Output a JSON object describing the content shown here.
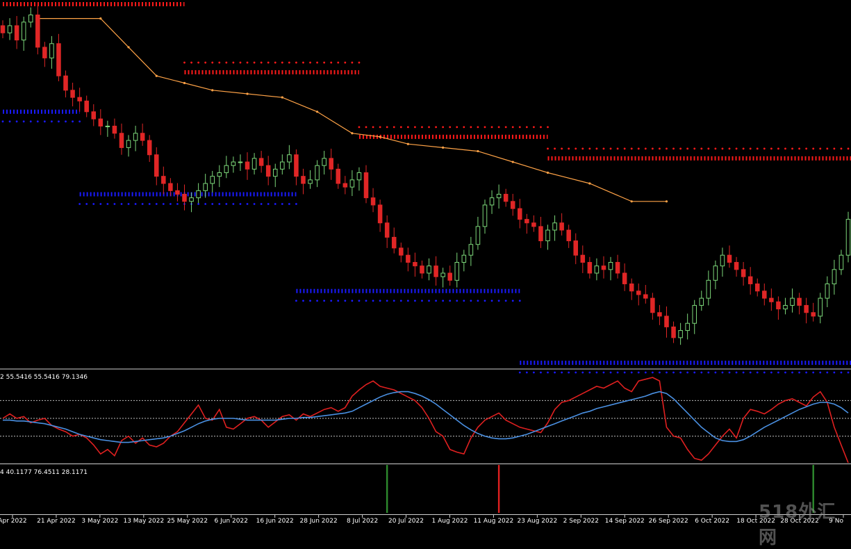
{
  "panels": {
    "main": {
      "label": "",
      "colors": {
        "bull": "#7dd87a",
        "bear": "#e02626",
        "resistance": "#ff1a1a",
        "support": "#1a1aff",
        "trail": "#ffa347",
        "trail_up": "#c8ff6a"
      }
    },
    "oscillator": {
      "label": "2 55.5416 55.5416 79.1346",
      "levels": [
        70,
        50,
        30
      ],
      "colors": {
        "main": "#e02020",
        "signal": "#4a90e2",
        "low": "#e8e84a",
        "green": "#2e8b2e"
      }
    },
    "signals": {
      "label": "4 40.1177 76.4511 28.1171",
      "colors": {
        "buy": "#2e8b2e",
        "sell": "#e02020"
      }
    }
  },
  "watermark": "518外汇网",
  "chart_data": [
    {
      "type": "candlestick",
      "title": "",
      "xlabel": "",
      "ylabel": "",
      "x_tick_labels": [
        "Apr 2022",
        "21 Apr 2022",
        "3 May 2022",
        "13 May 2022",
        "25 May 2022",
        "6 Jun 2022",
        "16 Jun 2022",
        "28 Jun 2022",
        "8 Jul 2022",
        "20 Jul 2022",
        "1 Aug 2022",
        "11 Aug 2022",
        "23 Aug 2022",
        "2 Sep 2022",
        "14 Sep 2022",
        "26 Sep 2022",
        "6 Oct 2022",
        "18 Oct 2022",
        "28 Oct 2022",
        "9 No"
      ],
      "ylim": [
        0,
        100
      ],
      "close": [
        92,
        94,
        90,
        95,
        97,
        88,
        85,
        89,
        80,
        76,
        74,
        73,
        70,
        68,
        66,
        66,
        64,
        60,
        62,
        64,
        62,
        58,
        52,
        50,
        48,
        47,
        45,
        46,
        48,
        50,
        52,
        53,
        55,
        56,
        56,
        54,
        57,
        55,
        52,
        54,
        56,
        58,
        52,
        50,
        51,
        55,
        57,
        54,
        50,
        49,
        51,
        53,
        46,
        44,
        39,
        35,
        32,
        30,
        28,
        27,
        25,
        27,
        24,
        25,
        23,
        28,
        30,
        33,
        38,
        44,
        46,
        47,
        45,
        43,
        40,
        39,
        38,
        34,
        37,
        39,
        37,
        34,
        30,
        28,
        25,
        27,
        26,
        28,
        25,
        22,
        20,
        19,
        18,
        14,
        13,
        10,
        7,
        9,
        11,
        16,
        18,
        23,
        27,
        30,
        28,
        26,
        24,
        22,
        20,
        18,
        17,
        15,
        16,
        18,
        16,
        14,
        13,
        18,
        22,
        26,
        30,
        40
      ],
      "resistance_levels": [
        [
          0,
          26,
          100
        ],
        [
          26,
          51,
          81
        ],
        [
          51,
          78,
          63
        ],
        [
          78,
          122,
          57
        ]
      ],
      "support_levels": [
        [
          0,
          11,
          70
        ],
        [
          11,
          42,
          47
        ],
        [
          42,
          74,
          20
        ],
        [
          74,
          122,
          0
        ]
      ],
      "trail_line": [
        [
          5,
          96
        ],
        [
          14,
          96
        ],
        [
          18,
          88
        ],
        [
          22,
          80
        ],
        [
          26,
          78
        ],
        [
          30,
          76
        ],
        [
          35,
          75
        ],
        [
          40,
          74
        ],
        [
          45,
          70
        ],
        [
          50,
          64
        ],
        [
          54,
          63
        ],
        [
          58,
          61
        ],
        [
          63,
          60
        ],
        [
          68,
          59
        ],
        [
          73,
          56
        ],
        [
          78,
          53
        ],
        [
          84,
          50
        ],
        [
          90,
          45
        ],
        [
          95,
          45
        ]
      ]
    },
    {
      "type": "line",
      "title": "",
      "x_tick_labels": [],
      "ylim": [
        0,
        100
      ],
      "levels": [
        70,
        50,
        30
      ],
      "series": [
        {
          "values": [
            50,
            55,
            50,
            52,
            45,
            48,
            50,
            42,
            38,
            35,
            30,
            32,
            28,
            20,
            10,
            15,
            8,
            25,
            30,
            22,
            28,
            20,
            18,
            22,
            30,
            35,
            45,
            55,
            65,
            50,
            48,
            60,
            40,
            38,
            44,
            50,
            52,
            48,
            40,
            46,
            52,
            54,
            48,
            55,
            52,
            56,
            60,
            62,
            58,
            62,
            75,
            82,
            88,
            92,
            86,
            84,
            82,
            78,
            74,
            70,
            62,
            50,
            35,
            30,
            15,
            12,
            10,
            28,
            40,
            48,
            52,
            56,
            48,
            44,
            40,
            38,
            36,
            34,
            45,
            60,
            68,
            70,
            74,
            78,
            82,
            86,
            84,
            88,
            92,
            84,
            80,
            92,
            94,
            96,
            92,
            40,
            30,
            28,
            15,
            5,
            3,
            10,
            20,
            30,
            38,
            28,
            50,
            60,
            58,
            55,
            60,
            66,
            70,
            72,
            68,
            64,
            74,
            80,
            68,
            40,
            20,
            0
          ],
          "color": "#e02020"
        },
        {
          "values": [
            48,
            48,
            47,
            47,
            46,
            45,
            44,
            42,
            40,
            38,
            35,
            32,
            30,
            28,
            26,
            25,
            24,
            23,
            23,
            24,
            25,
            26,
            27,
            28,
            30,
            33,
            36,
            40,
            44,
            47,
            49,
            50,
            50,
            50,
            49,
            48,
            48,
            48,
            48,
            48,
            49,
            50,
            50,
            51,
            51,
            52,
            53,
            54,
            55,
            56,
            58,
            62,
            66,
            70,
            74,
            77,
            79,
            80,
            80,
            78,
            75,
            71,
            66,
            60,
            54,
            48,
            42,
            37,
            33,
            30,
            28,
            27,
            27,
            28,
            30,
            32,
            35,
            38,
            41,
            44,
            47,
            50,
            53,
            56,
            58,
            61,
            63,
            65,
            67,
            69,
            71,
            73,
            75,
            78,
            80,
            78,
            72,
            64,
            56,
            48,
            40,
            34,
            28,
            25,
            24,
            24,
            26,
            30,
            35,
            40,
            44,
            48,
            52,
            56,
            60,
            63,
            66,
            68,
            68,
            66,
            62,
            56
          ],
          "color": "#4a90e2"
        }
      ]
    },
    {
      "type": "bar",
      "title": "",
      "ylim": [
        0,
        1
      ],
      "events": [
        {
          "index": 55,
          "value": 1,
          "kind": "buy"
        },
        {
          "index": 71,
          "value": 1,
          "kind": "sell"
        },
        {
          "index": 116,
          "value": 1,
          "kind": "buy"
        }
      ]
    }
  ]
}
